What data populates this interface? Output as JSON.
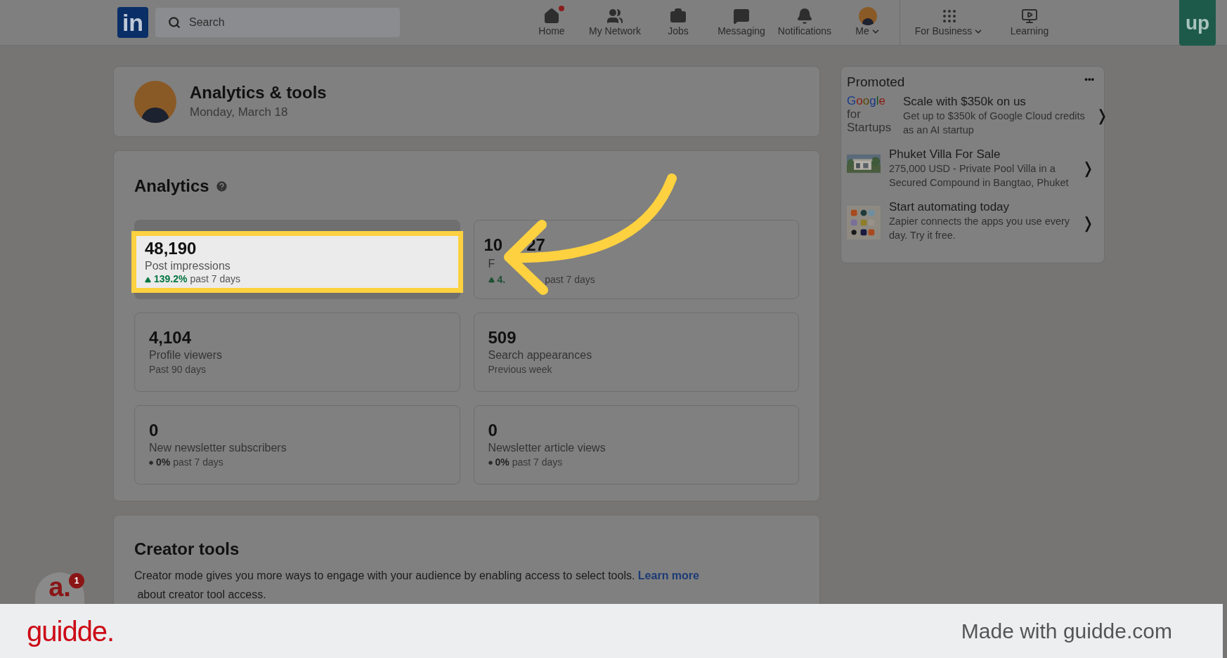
{
  "nav": {
    "logo": "in",
    "search_placeholder": "Search",
    "items": [
      {
        "kind": "home",
        "label": "Home",
        "badge": true,
        "dropdown": false
      },
      {
        "kind": "network",
        "label": "My Network",
        "badge": false,
        "dropdown": false
      },
      {
        "kind": "jobs",
        "label": "Jobs",
        "badge": false,
        "dropdown": false
      },
      {
        "kind": "messaging",
        "label": "Messaging",
        "badge": false,
        "dropdown": false
      },
      {
        "kind": "notifications",
        "label": "Notifications",
        "badge": false,
        "dropdown": false
      },
      {
        "kind": "me",
        "label": "Me",
        "badge": false,
        "dropdown": true
      },
      {
        "kind": "business",
        "label": "For Business",
        "badge": false,
        "dropdown": true
      },
      {
        "kind": "learning",
        "label": "Learning",
        "badge": false,
        "dropdown": false
      }
    ],
    "corner_logo": "up"
  },
  "header": {
    "title": "Analytics & tools",
    "date": "Monday, March 18"
  },
  "analytics": {
    "title": "Analytics",
    "cards": [
      {
        "kind": "highlighted",
        "number": "48,190",
        "label": "Post impressions",
        "change": "139.2%",
        "period": "past 7 days"
      },
      {
        "kind": "covered",
        "number_start": "10",
        "number_end": "27",
        "label": "F",
        "change": "4.",
        "period": "past 7 days"
      },
      {
        "kind": "plain",
        "number": "4,104",
        "label": "Profile viewers",
        "period": "Past 90 days"
      },
      {
        "kind": "plain",
        "number": "509",
        "label": "Search appearances",
        "period": "Previous week"
      },
      {
        "kind": "change",
        "number": "0",
        "label": "New newsletter subscribers",
        "change": "0%",
        "period": "past 7 days"
      },
      {
        "kind": "change",
        "number": "0",
        "label": "Newsletter article views",
        "change": "0%",
        "period": "past 7 days"
      }
    ]
  },
  "creator_tools": {
    "title": "Creator tools",
    "text": "Creator mode gives you more ways to engage with your audience by enabling access to select tools.",
    "link": "Learn more",
    "text_end": "about creator tool access."
  },
  "promoted": {
    "title": "Promoted",
    "more": "•••",
    "ads": [
      {
        "kind": "google",
        "logo_word": "Google",
        "logo_sub": "for Startups",
        "title": "Scale with $350k on us",
        "text": "Get up to $350k of Google Cloud credits as an AI startup",
        "chevron": "❭"
      },
      {
        "title": "Phuket Villa For Sale",
        "text": "275,000 USD - Private Pool Villa in a Secured Compound in Bangtao, Phuket",
        "chevron": "❭"
      },
      {
        "kind": "apps",
        "title": "Start automating today",
        "text": "Zapier connects the apps you use every day. Try it free.",
        "chevron": "❭"
      }
    ]
  },
  "assistant": {
    "letter": "a.",
    "count": "1"
  },
  "footer": {
    "brand": "guidde.",
    "credit": "Made with guidde.com"
  }
}
